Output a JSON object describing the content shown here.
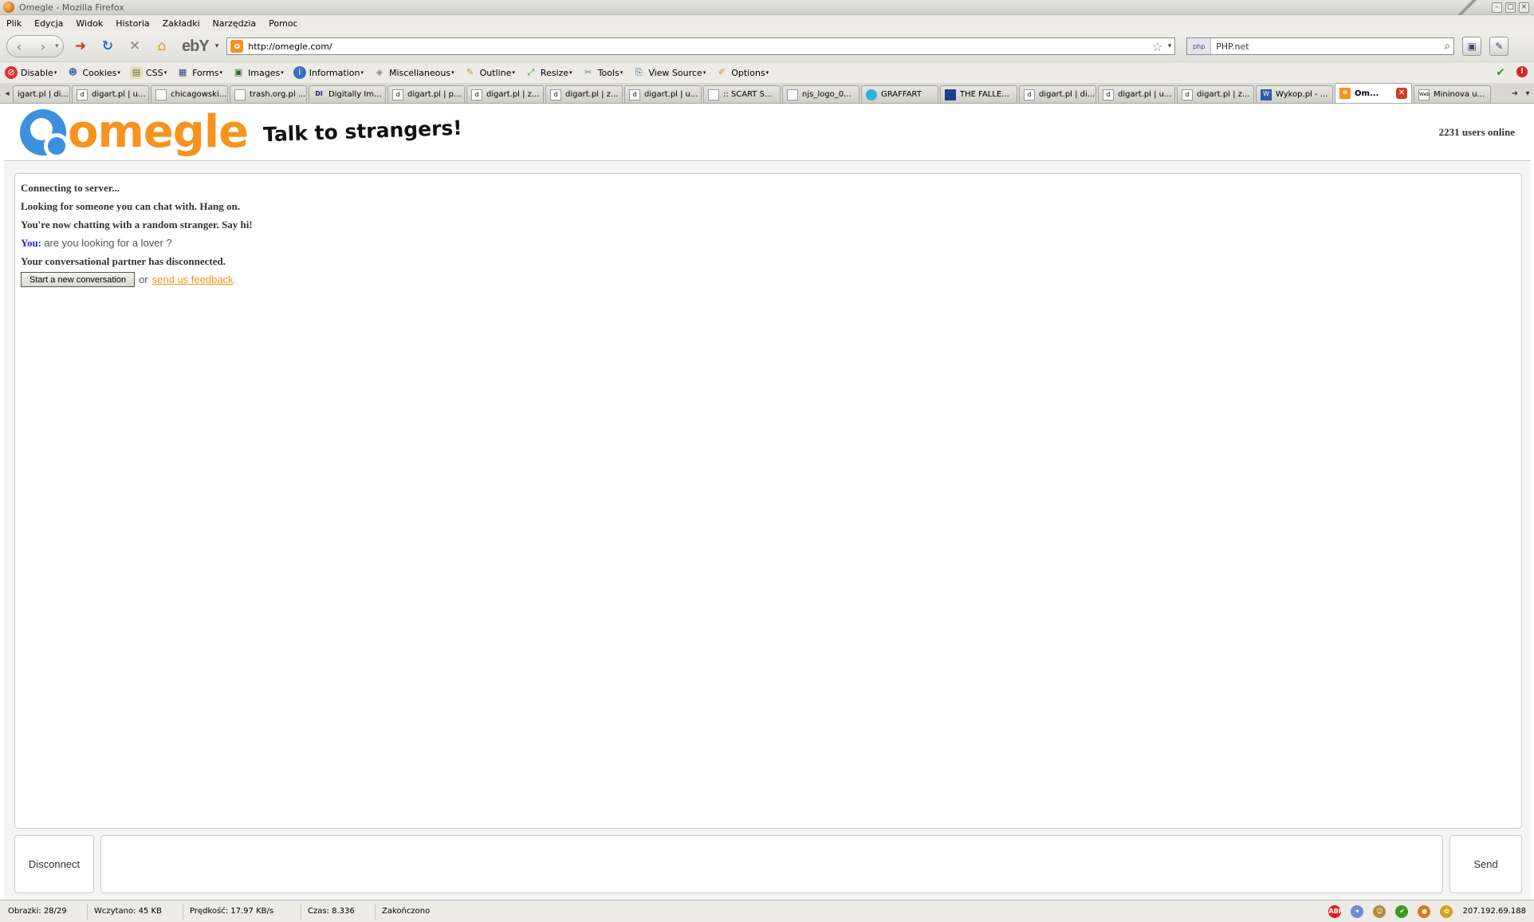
{
  "window": {
    "title": "Omegle - Mozilla Firefox"
  },
  "menu": [
    "Plik",
    "Edycja",
    "Widok",
    "Historia",
    "Zakładki",
    "Narzędzia",
    "Pomoc"
  ],
  "nav": {
    "url": "http://omegle.com/",
    "search_value": "PHP.net",
    "search_engine": "php",
    "ebay_label": "ebY"
  },
  "devbar": {
    "items": [
      {
        "label": "Disable",
        "icon": "disable-icon"
      },
      {
        "label": "Cookies",
        "icon": "cookies-icon"
      },
      {
        "label": "CSS",
        "icon": "css-icon"
      },
      {
        "label": "Forms",
        "icon": "forms-icon"
      },
      {
        "label": "Images",
        "icon": "images-icon"
      },
      {
        "label": "Information",
        "icon": "information-icon"
      },
      {
        "label": "Miscellaneous",
        "icon": "miscellaneous-icon"
      },
      {
        "label": "Outline",
        "icon": "outline-icon"
      },
      {
        "label": "Resize",
        "icon": "resize-icon"
      },
      {
        "label": "Tools",
        "icon": "tools-icon"
      },
      {
        "label": "View Source",
        "icon": "view-source-icon"
      },
      {
        "label": "Options",
        "icon": "options-icon"
      }
    ]
  },
  "tabs": [
    {
      "label": "igart.pl | di..."
    },
    {
      "label": "digart.pl | u..."
    },
    {
      "label": "chicagowski..."
    },
    {
      "label": "trash.org.pl ..."
    },
    {
      "label": "Digitally Im..."
    },
    {
      "label": "digart.pl | p..."
    },
    {
      "label": "digart.pl | z..."
    },
    {
      "label": "digart.pl | z..."
    },
    {
      "label": "digart.pl | u..."
    },
    {
      "label": ":: SCART S..."
    },
    {
      "label": "njs_logo_0..."
    },
    {
      "label": "GRAFFART"
    },
    {
      "label": "THE FALLE..."
    },
    {
      "label": "digart.pl | di..."
    },
    {
      "label": "digart.pl | u..."
    },
    {
      "label": "digart.pl | z..."
    },
    {
      "label": "Wykop.pl - ..."
    },
    {
      "label": "Om...",
      "active": true
    },
    {
      "label": "Mininova u..."
    }
  ],
  "omegle": {
    "logo_text": "omegle",
    "tagline": "Talk to strangers!",
    "users_online": "2231 users online",
    "log": {
      "status1": "Connecting to server...",
      "status2": "Looking for someone you can chat with. Hang on.",
      "status3": "You're now chatting with a random stranger. Say hi!",
      "you_label": "You:",
      "you_message": "are you looking for a lover ?",
      "status4": "Your conversational partner has disconnected.",
      "new_conversation_button": "Start a new conversation",
      "or_text": "or",
      "feedback_link": "send us feedback",
      "feedback_period": "."
    },
    "disconnect_label": "Disconnect",
    "send_label": "Send",
    "accent_color": "#f7931e",
    "you_color": "#2323d6"
  },
  "statusbar": {
    "images": "Obrazki: 28/29",
    "loaded": "Wczytano: 45 KB",
    "speed": "Prędkość: 17.97 KB/s",
    "time": "Czas: 8.336",
    "state": "Zakończono",
    "ip": "207.192.69.188"
  }
}
